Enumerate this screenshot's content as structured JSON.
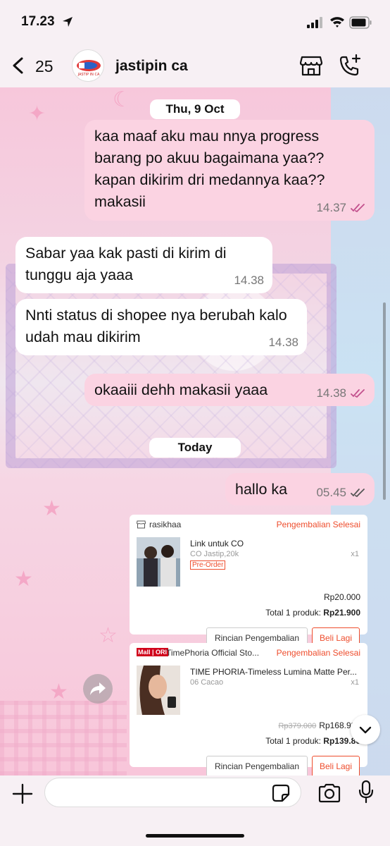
{
  "status_bar": {
    "time": "17.23"
  },
  "header": {
    "back_count": "25",
    "contact_name": "jastipin ca",
    "avatar_text": "JASTIP IN CA"
  },
  "chat": {
    "date_1": "Thu, 9 Oct",
    "messages": [
      {
        "dir": "out",
        "text": "kaa maaf aku mau nnya progress barang po akuu bagaimana yaa?? kapan dikirim dri medannya kaa?? makasii",
        "time": "14.37",
        "read": true
      },
      {
        "dir": "in",
        "text": "Sabar yaa kak pasti di kirim di tunggu aja yaaa",
        "time": "14.38"
      },
      {
        "dir": "in",
        "text": "Nnti status di shopee nya berubah kalo udah mau dikirim",
        "time": "14.38"
      },
      {
        "dir": "out",
        "text": "okaaiii dehh makasii yaaa",
        "time": "14.38",
        "read": true
      },
      {
        "dir": "out",
        "text": "hallo ka",
        "time": "05.45",
        "read": false
      }
    ],
    "date_2": "Today"
  },
  "orders": [
    {
      "store": "rasikhaa",
      "status": "Pengembalian Selesai",
      "product_name": "Link untuk CO",
      "variant": "CO Jastip,20k",
      "tag": "Pre-Order",
      "qty": "x1",
      "price": "Rp20.000",
      "total_label": "Total 1 produk:",
      "total": "Rp21.900",
      "btn_detail": "Rincian Pengembalian",
      "btn_buy": "Beli Lagi"
    },
    {
      "mall_badge": "Mall | ORI",
      "store": "TimePhoria Official Sto...",
      "status": "Pengembalian Selesai",
      "product_name": "TIME PHORIA-Timeless Lumina Matte Per...",
      "variant": "06 Cacao",
      "qty": "x1",
      "old_price": "Rp379.000",
      "price": "Rp168.984",
      "total_label": "Total 1 produk:",
      "total": "Rp139.80",
      "btn_detail": "Rincian Pengembalian",
      "btn_buy": "Beli Lagi"
    }
  ],
  "composer": {
    "placeholder": ""
  },
  "colors": {
    "outgoing_bubble": "#fbd3e2",
    "incoming_bubble": "#ffffff",
    "read_ticks": "#c2508d",
    "shopee_orange": "#ee4d2d"
  }
}
